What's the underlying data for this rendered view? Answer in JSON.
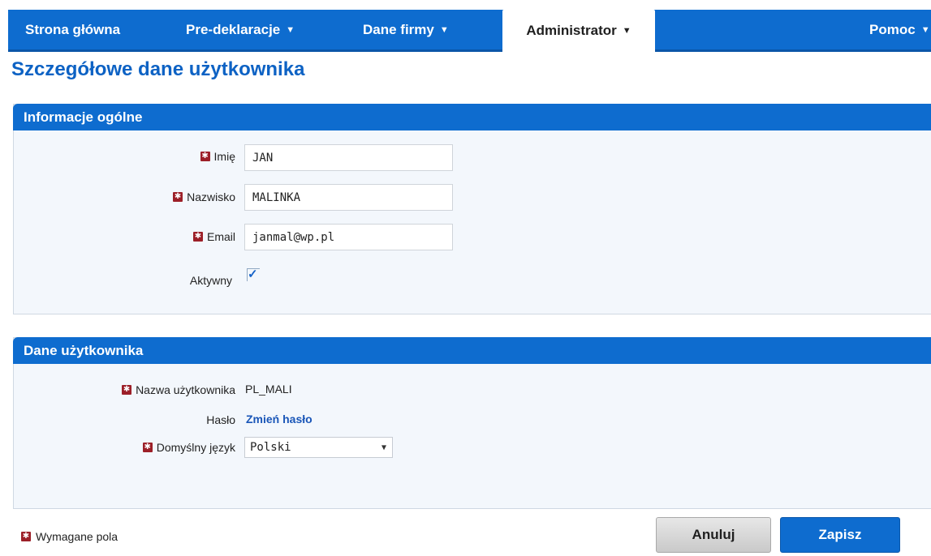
{
  "nav": {
    "items": [
      {
        "label": "Strona główna",
        "caret": ""
      },
      {
        "label": "Pre-deklaracje",
        "caret": "▼"
      },
      {
        "label": "Dane firmy",
        "caret": "▼"
      },
      {
        "label": "Administrator",
        "caret": "▼"
      },
      {
        "label": "Pomoc",
        "caret": "▼"
      }
    ],
    "active": "Administrator"
  },
  "page_title": "Szczegółowe dane użytkownika",
  "general": {
    "header": "Informacje ogólne",
    "first_name_label": "Imię",
    "first_name_value": "JAN",
    "last_name_label": "Nazwisko",
    "last_name_value": "MALINKA",
    "email_label": "Email",
    "email_value": "janmal@wp.pl",
    "active_label": "Aktywny",
    "active_checked": true,
    "check_mark": "✓"
  },
  "user": {
    "header": "Dane użytkownika",
    "username_label": "Nazwa użytkownika",
    "username_value": "PL_MALI",
    "password_label": "Hasło",
    "change_password_link": "Zmień hasło",
    "language_label": "Domyślny język",
    "language_value": "Polski",
    "language_arrow": "▼"
  },
  "footer": {
    "required_note": "Wymagane pola",
    "cancel_label": "Anuluj",
    "save_label": "Zapisz"
  },
  "colors": {
    "accent": "#0e6ccf",
    "title": "#0d62c4",
    "required": "#9c1f28",
    "panel_bg": "#f3f7fc"
  },
  "icons": {
    "required": "required-star-icon",
    "checkbox": "check-icon",
    "dropdown": "chevron-down-icon"
  }
}
